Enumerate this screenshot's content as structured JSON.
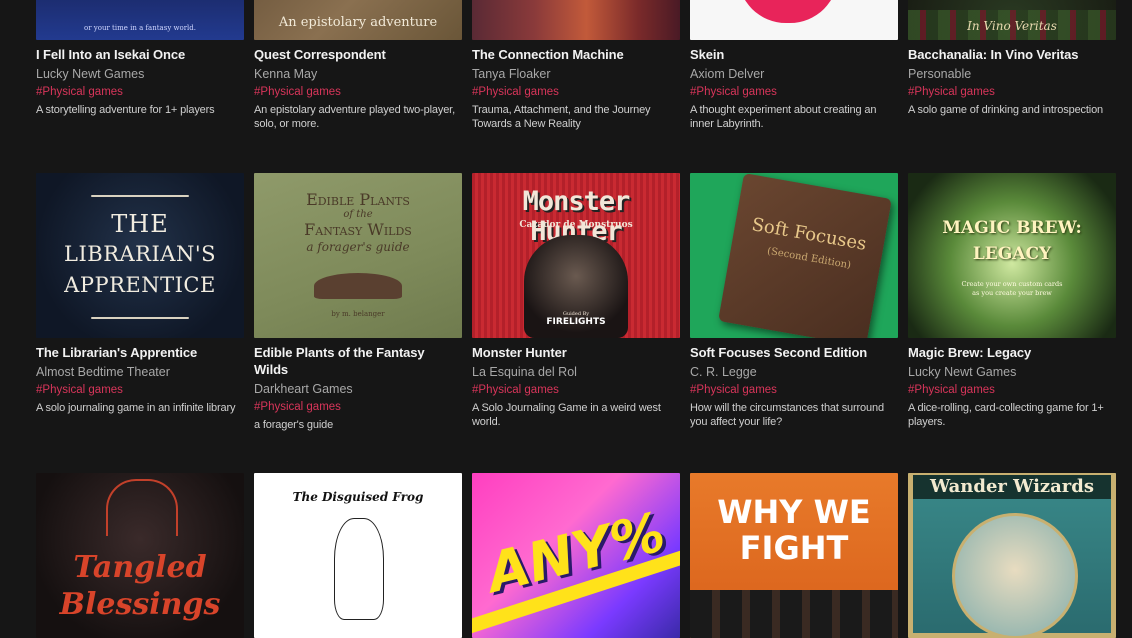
{
  "games": [
    {
      "title": "I Fell Into an Isekai Once",
      "author": "Lucky Newt Games",
      "tag": "#Physical games",
      "desc": "A storytelling adventure for 1+ players",
      "cover_text": "or your time in a fantasy world."
    },
    {
      "title": "Quest Correspondent",
      "author": "Kenna May",
      "tag": "#Physical games",
      "desc": "An epistolary adventure played two-player, solo, or more.",
      "cover_text": "An epistolary adventure"
    },
    {
      "title": "The Connection Machine",
      "author": "Tanya Floaker",
      "tag": "#Physical games",
      "desc": "Trauma, Attachment, and the Journey Towards a New Reality"
    },
    {
      "title": "Skein",
      "author": "Axiom Delver",
      "tag": "#Physical games",
      "desc": "A thought experiment about creating an inner Labyrinth."
    },
    {
      "title": "Bacchanalia: In Vino Veritas",
      "author": "Personable",
      "tag": "#Physical games",
      "desc": "A solo game of drinking and introspection",
      "cover_text": "In Vino Veritas"
    },
    {
      "title": "The Librarian's Apprentice",
      "author": "Almost Bedtime Theater",
      "tag": "#Physical games",
      "desc": "A solo journaling game in an infinite library",
      "cover_text": [
        "THE",
        "LIBRARIAN'S",
        "APPRENTICE"
      ]
    },
    {
      "title": "Edible Plants of the Fantasy Wilds",
      "author": "Darkheart Games",
      "tag": "#Physical games",
      "desc": "a forager's guide",
      "cover_text": [
        "Edible Plants",
        "of the",
        "Fantasy Wilds",
        "a forager's guide",
        "by m. belanger"
      ]
    },
    {
      "title": "Monster Hunter",
      "author": "La Esquina del Rol",
      "tag": "#Physical games",
      "desc": "A Solo Journaling Game in a weird west world.",
      "cover_text": [
        "Monster Hunter",
        "Cazador de Monstruos",
        "Guided By",
        "FIRELIGHTS"
      ]
    },
    {
      "title": "Soft Focuses Second Edition",
      "author": "C. R. Legge",
      "tag": "#Physical games",
      "desc": "How will the circumstances that surround you affect your life?",
      "cover_text": [
        "Soft Focuses",
        "(Second Edition)"
      ]
    },
    {
      "title": "Magic Brew: Legacy",
      "author": "Lucky Newt Games",
      "tag": "#Physical games",
      "desc": "A dice-rolling, card-collecting game for 1+ players.",
      "cover_text": [
        "MAGIC BREW:",
        "LEGACY",
        "Create your own custom cards",
        "as you create your brew"
      ]
    },
    {
      "cover_text": [
        "Tangled",
        "Blessings"
      ]
    },
    {
      "cover_text": [
        "The Disguised Frog"
      ]
    },
    {
      "cover_text": [
        "ANY%"
      ]
    },
    {
      "cover_text": [
        "WHY WE",
        "FIGHT"
      ]
    },
    {
      "cover_text": [
        "Wander Wizards"
      ]
    }
  ],
  "colors": {
    "background": "#161616",
    "tag": "#d8355a",
    "title": "#f2f2f2",
    "author": "#a8a8a8"
  }
}
